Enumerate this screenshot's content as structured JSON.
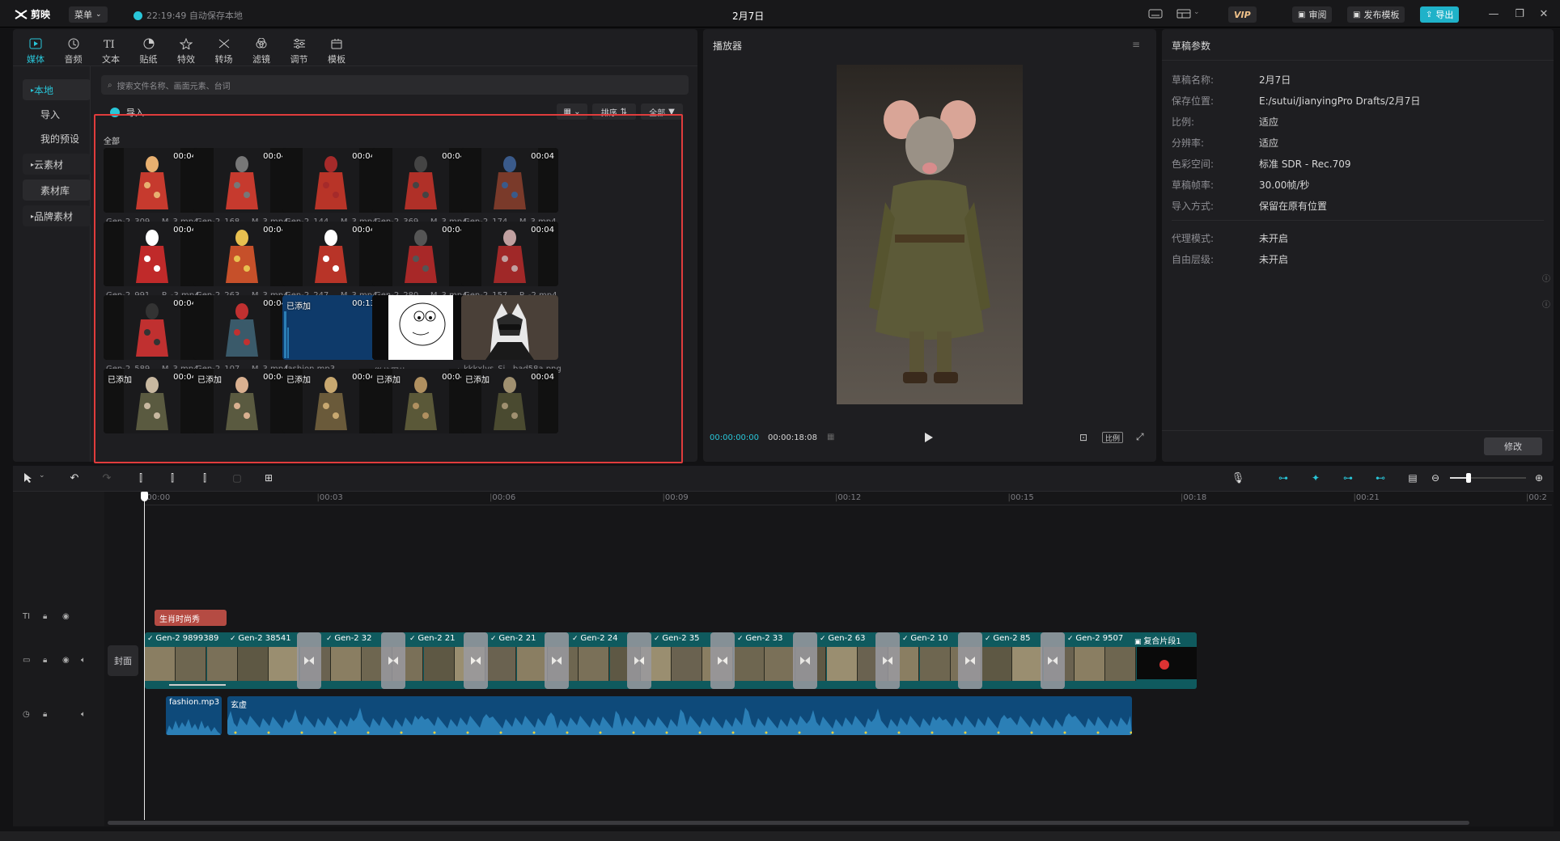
{
  "titlebar": {
    "app_name": "剪映",
    "menu_label": "菜单",
    "autosave": "22:19:49 自动保存本地",
    "project_title": "2月7日",
    "vip_label": "VIP",
    "review_label": "审阅",
    "publish_label": "发布模板",
    "export_label": "导出"
  },
  "categories": [
    {
      "label": "媒体",
      "icon": "media-icon"
    },
    {
      "label": "音频",
      "icon": "audio-icon"
    },
    {
      "label": "文本",
      "icon": "text-icon"
    },
    {
      "label": "贴纸",
      "icon": "sticker-icon"
    },
    {
      "label": "特效",
      "icon": "effects-icon"
    },
    {
      "label": "转场",
      "icon": "transition-icon"
    },
    {
      "label": "滤镜",
      "icon": "filter-icon"
    },
    {
      "label": "调节",
      "icon": "adjust-icon"
    },
    {
      "label": "模板",
      "icon": "template-icon"
    }
  ],
  "sidebar": {
    "items": [
      "本地",
      "导入",
      "我的预设",
      "云素材",
      "素材库",
      "品牌素材"
    ]
  },
  "media": {
    "search_placeholder": "搜索文件名称、画面元素、台词",
    "import_label": "导入",
    "sort_label": "排序",
    "filter_label": "全部",
    "section_label": "全部",
    "added_label": "已添加",
    "items": [
      {
        "name": "Gen-2_309..._M_3.mp4",
        "duration": "00:04"
      },
      {
        "name": "Gen-2_168..._M_3.mp4",
        "duration": "00:04"
      },
      {
        "name": "Gen-2_144..._M_3.mp4",
        "duration": "00:04"
      },
      {
        "name": "Gen-2_369..._M_3.mp4",
        "duration": "00:04"
      },
      {
        "name": "Gen-2_174..._M_3.mp4",
        "duration": "00:04"
      },
      {
        "name": "Gen-2_991..._P_-3.mp4",
        "duration": "00:04"
      },
      {
        "name": "Gen-2_263..._M_3.mp4",
        "duration": "00:04"
      },
      {
        "name": "Gen-2_247..._M_3.mp4",
        "duration": "00:04"
      },
      {
        "name": "Gen-2_280..._M_3.mp4",
        "duration": "00:04"
      },
      {
        "name": "Gen-2_157..._P_-2.mp4",
        "duration": "00:04"
      },
      {
        "name": "Gen-2_589..._M_3.mp4",
        "duration": "00:04"
      },
      {
        "name": "Gen-2_107..._M_3.mp4",
        "duration": "00:04"
      },
      {
        "name": "fashion.mp3",
        "duration": "00:13",
        "added": true
      },
      {
        "name": "微信图片_202...3316.jpg",
        "duration": ""
      },
      {
        "name": "kkkxlys_Si...bad58a.png",
        "duration": ""
      },
      {
        "name": "",
        "duration": "00:04",
        "added": true
      },
      {
        "name": "",
        "duration": "00:04",
        "added": true
      },
      {
        "name": "",
        "duration": "00:04",
        "added": true
      },
      {
        "name": "",
        "duration": "00:04",
        "added": true
      },
      {
        "name": "",
        "duration": "00:04",
        "added": true
      }
    ]
  },
  "player": {
    "title": "播放器",
    "current_time": "00:00:00:00",
    "total_time": "00:00:18:08",
    "ratio_label": "比例"
  },
  "properties": {
    "title": "草稿参数",
    "rows": [
      {
        "label": "草稿名称:",
        "value": "2月7日"
      },
      {
        "label": "保存位置:",
        "value": "E:/sutui/JianyingPro Drafts/2月7日"
      },
      {
        "label": "比例:",
        "value": "适应"
      },
      {
        "label": "分辨率:",
        "value": "适应"
      },
      {
        "label": "色彩空间:",
        "value": "标准 SDR - Rec.709"
      },
      {
        "label": "草稿帧率:",
        "value": "30.00帧/秒"
      },
      {
        "label": "导入方式:",
        "value": "保留在原有位置"
      },
      {
        "label": "代理模式:",
        "value": "未开启"
      },
      {
        "label": "自由层级:",
        "value": "未开启"
      }
    ],
    "edit_label": "修改"
  },
  "timeline": {
    "ticks": [
      "00:00",
      "00:03",
      "00:06",
      "00:09",
      "00:12",
      "00:15",
      "00:18",
      "00:21",
      "00:2"
    ],
    "text_clip": "生肖时尚秀",
    "cover_label": "封面",
    "video_clips": [
      "Gen-2 9899389",
      "Gen-2 38541",
      "Gen-2 32",
      "Gen-2 21",
      "Gen-2 21",
      "Gen-2 24",
      "Gen-2 35",
      "Gen-2 33",
      "Gen-2 63",
      "Gen-2 10",
      "Gen-2 85",
      "Gen-2 9507"
    ],
    "compound_label": "复合片段1",
    "audio_clip": "fashion.mp3",
    "audio_clip2": "玄虚"
  },
  "colors": {
    "accent": "#29c6d9",
    "highlight_border": "#e03c3c",
    "audio_clip": "#0e4a7a",
    "video_track": "#0f5a5e",
    "text_clip": "#b54b43"
  }
}
